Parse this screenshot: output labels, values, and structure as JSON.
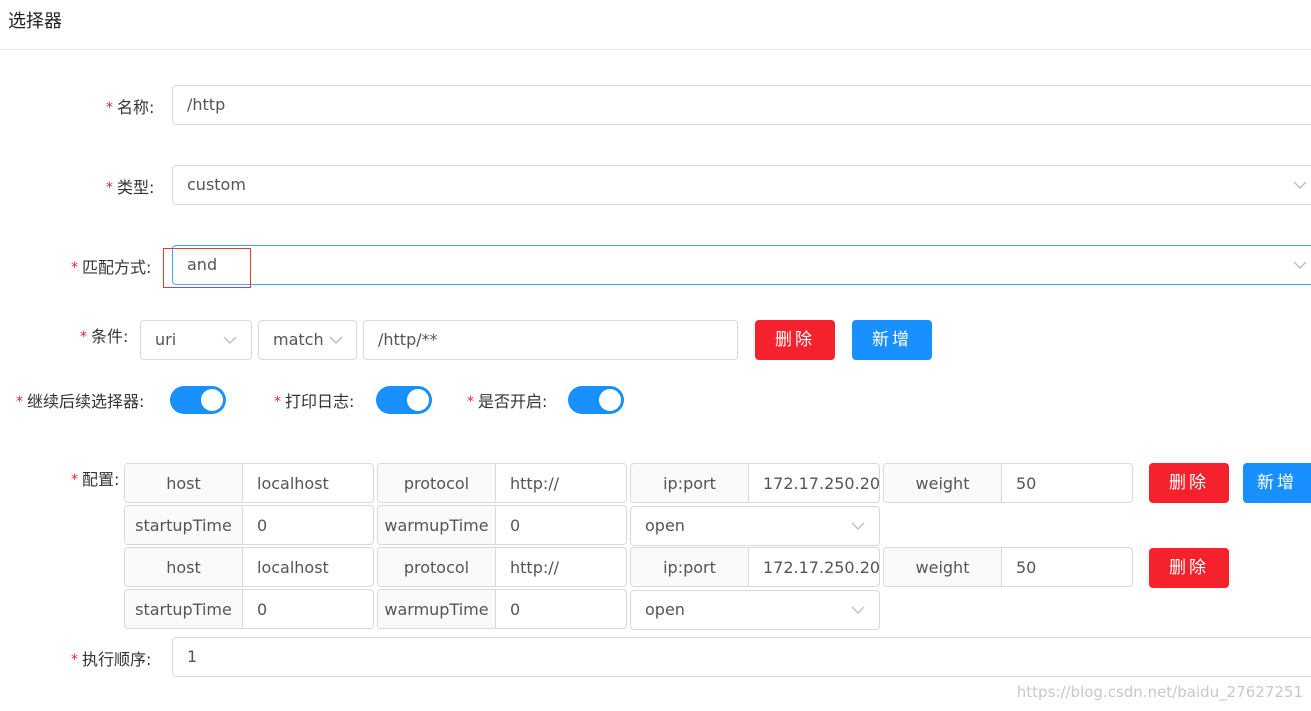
{
  "page": {
    "title": "选择器"
  },
  "form": {
    "name": {
      "label": "名称:",
      "value": "/http"
    },
    "type": {
      "label": "类型:",
      "value": "custom"
    },
    "match_mode": {
      "label": "匹配方式:",
      "value": "and"
    },
    "condition": {
      "label": "条件:",
      "param": "uri",
      "operator": "match",
      "value": "/http/**",
      "delete_label": "删除",
      "add_label": "新增"
    },
    "toggles": [
      {
        "label": "继续后续选择器:",
        "on": true
      },
      {
        "label": "打印日志:",
        "on": true
      },
      {
        "label": "是否开启:",
        "on": true
      }
    ],
    "config": {
      "label": "配置:",
      "delete_label": "删除",
      "add_label": "新增",
      "rows": [
        {
          "host_label": "host",
          "host": "localhost",
          "protocol_label": "protocol",
          "protocol": "http://",
          "ipport_label": "ip:port",
          "ipport": "172.17.250.20",
          "weight_label": "weight",
          "weight": "50",
          "startup_label": "startupTime",
          "startup": "0",
          "warmup_label": "warmupTime",
          "warmup": "0",
          "status": "open"
        },
        {
          "host_label": "host",
          "host": "localhost",
          "protocol_label": "protocol",
          "protocol": "http://",
          "ipport_label": "ip:port",
          "ipport": "172.17.250.20",
          "weight_label": "weight",
          "weight": "50",
          "startup_label": "startupTime",
          "startup": "0",
          "warmup_label": "warmupTime",
          "warmup": "0",
          "status": "open"
        }
      ]
    },
    "order": {
      "label": "执行顺序:",
      "value": "1"
    }
  },
  "watermark": "https://blog.csdn.net/baidu_27627251",
  "colors": {
    "primary": "#1890ff",
    "danger": "#f5222d",
    "required": "#f5222d"
  },
  "icons": {
    "dropdown": "chevron-down-icon"
  }
}
